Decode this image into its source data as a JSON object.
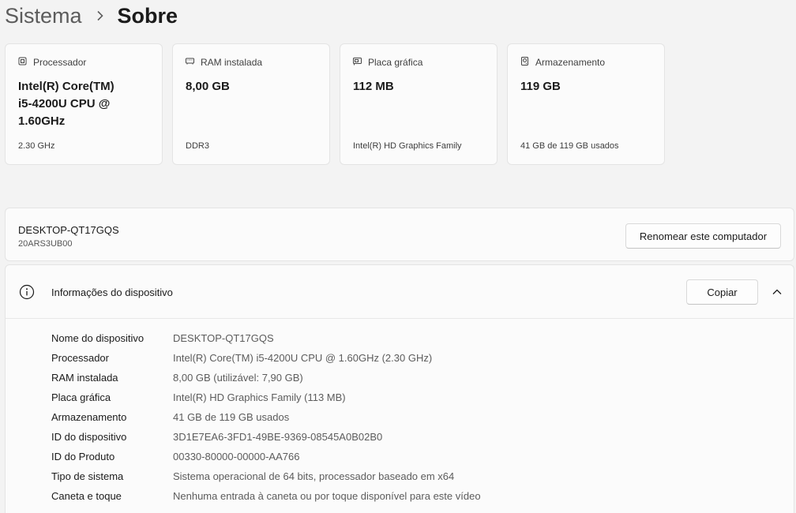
{
  "breadcrumb": {
    "parent": "Sistema",
    "current": "Sobre"
  },
  "cards": [
    {
      "icon": "processor-icon",
      "label": "Processador",
      "value": "Intel(R) Core(TM) i5-4200U CPU @ 1.60GHz",
      "sub": "2.30 GHz"
    },
    {
      "icon": "ram-icon",
      "label": "RAM instalada",
      "value": "8,00 GB",
      "sub": "DDR3"
    },
    {
      "icon": "graphics-card-icon",
      "label": "Placa gráfica",
      "value": "112 MB",
      "sub": "Intel(R) HD Graphics Family"
    },
    {
      "icon": "storage-icon",
      "label": "Armazenamento",
      "value": "119 GB",
      "sub": "41 GB de 119 GB usados"
    }
  ],
  "computer": {
    "name": "DESKTOP-QT17GQS",
    "model": "20ARS3UB00",
    "rename_label": "Renomear este computador"
  },
  "device_info": {
    "title": "Informações do dispositivo",
    "copy_label": "Copiar",
    "rows": [
      {
        "label": "Nome do dispositivo",
        "value": "DESKTOP-QT17GQS"
      },
      {
        "label": "Processador",
        "value": "Intel(R) Core(TM) i5-4200U CPU @ 1.60GHz   (2.30 GHz)"
      },
      {
        "label": "RAM instalada",
        "value": "8,00 GB (utilizável: 7,90 GB)"
      },
      {
        "label": "Placa gráfica",
        "value": "Intel(R) HD Graphics Family (113 MB)"
      },
      {
        "label": "Armazenamento",
        "value": "41 GB de 119 GB usados"
      },
      {
        "label": "ID do dispositivo",
        "value": "3D1E7EA6-3FD1-49BE-9369-08545A0B02B0"
      },
      {
        "label": "ID do Produto",
        "value": "00330-80000-00000-AA766"
      },
      {
        "label": "Tipo de sistema",
        "value": "Sistema operacional de 64 bits, processador baseado em x64"
      },
      {
        "label": "Caneta e toque",
        "value": "Nenhuma entrada à caneta ou por toque disponível para este vídeo"
      }
    ]
  }
}
